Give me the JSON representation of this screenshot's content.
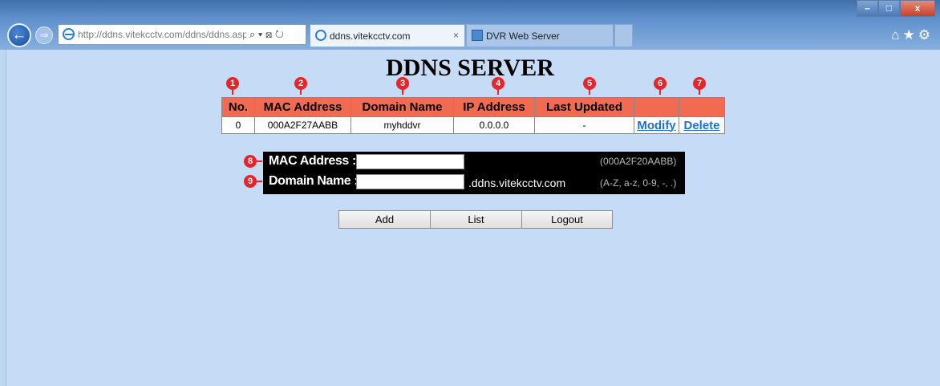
{
  "browser": {
    "address_url": "http://ddns.vitekcctv.com/ddns/ddns.asp?",
    "address_glyphs": "⌕ ▾ ⊠ ↻",
    "tabs": [
      {
        "title": "ddns.vitekcctv.com",
        "close": "×",
        "active": true
      },
      {
        "title": "DVR Web Server",
        "active": false
      }
    ],
    "window_buttons": {
      "minimize": "–",
      "maximize": "□",
      "close": "x"
    },
    "toolbar_icons": "⌂★⚙"
  },
  "page": {
    "title": "DDNS SERVER",
    "markers": [
      "1",
      "2",
      "3",
      "4",
      "5",
      "6",
      "7",
      "8",
      "9"
    ],
    "table": {
      "headers": [
        "No.",
        "MAC Address",
        "Domain Name",
        "IP Address",
        "Last Updated",
        "",
        ""
      ],
      "rows": [
        {
          "no": "0",
          "mac": "000A2F27AABB",
          "domain": "myhddvr",
          "ip": "0.0.0.0",
          "updated": "-",
          "modify": "Modify",
          "delete": "Delete"
        }
      ]
    },
    "form": {
      "mac_label": "MAC Address :",
      "mac_value": "",
      "mac_hint": "(000A2F20AABB)",
      "domain_label": "Domain Name :",
      "domain_value": "",
      "domain_suffix": ".ddns.vitekcctv.com",
      "domain_hint": "(A-Z, a-z, 0-9, -, .)"
    },
    "buttons": {
      "add": "Add",
      "list": "List",
      "logout": "Logout"
    }
  },
  "colors": {
    "page_bg": "#c6dcf6",
    "header_bg": "#f26a4f",
    "marker": "#e8242a",
    "link": "#1e6fd6",
    "form_bg": "#000000"
  }
}
